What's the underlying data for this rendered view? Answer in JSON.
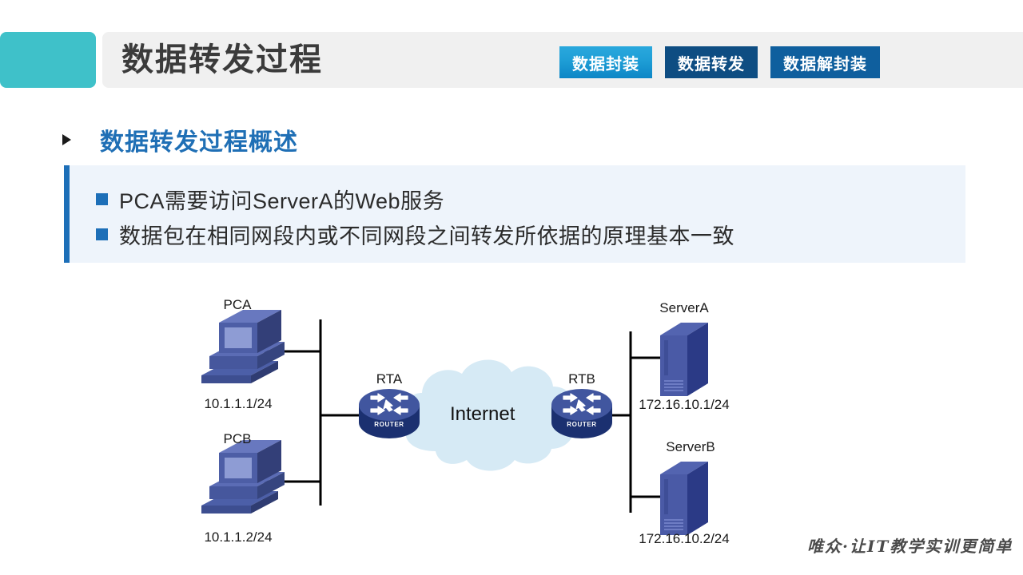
{
  "header": {
    "title": "数据转发过程",
    "accent_color": "#3fc1c9",
    "bar_color": "#f0f0f0",
    "tabs": [
      {
        "label": "数据封装",
        "state": "active",
        "color": "#1e9ed6"
      },
      {
        "label": "数据转发",
        "state": "inactive",
        "color": "#0e4d82"
      },
      {
        "label": "数据解封装",
        "state": "inactive",
        "color": "#0f5f9e"
      }
    ]
  },
  "section": {
    "title": "数据转发过程概述",
    "title_color": "#1f6fb5",
    "bullet_glyph": "triangle-right"
  },
  "content": {
    "background_color": "#eef4fb",
    "accent_color": "#1d6fb8",
    "bullets": [
      "PCA需要访问ServerA的Web服务",
      "数据包在相同网段内或不同网段之间转发所依据的原理基本一致"
    ]
  },
  "diagram": {
    "cloud_label": "Internet",
    "cloud_color": "#d6eaf5",
    "router_label_text": "ROUTER",
    "nodes": [
      {
        "id": "pca",
        "type": "pc",
        "label": "PCA",
        "ip": "10.1.1.1/24"
      },
      {
        "id": "pcb",
        "type": "pc",
        "label": "PCB",
        "ip": "10.1.1.2/24"
      },
      {
        "id": "rta",
        "type": "router",
        "label": "RTA",
        "ip": ""
      },
      {
        "id": "rtb",
        "type": "router",
        "label": "RTB",
        "ip": ""
      },
      {
        "id": "servera",
        "type": "server",
        "label": "ServerA",
        "ip": "172.16.10.1/24"
      },
      {
        "id": "serverb",
        "type": "server",
        "label": "ServerB",
        "ip": "172.16.10.2/24"
      }
    ]
  },
  "footer": {
    "branding": "唯众·让IT教学实训更简单"
  }
}
